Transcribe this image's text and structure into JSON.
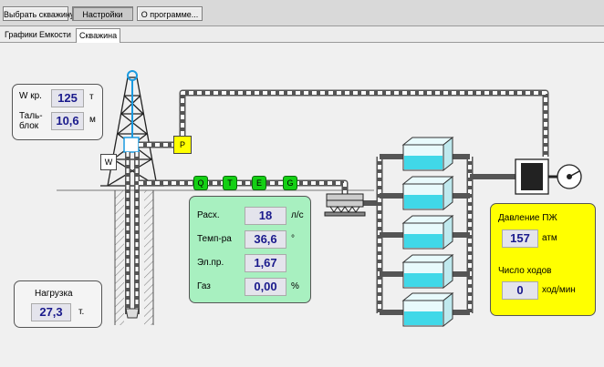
{
  "toolbar": {
    "select_well": "Выбрать скважину",
    "settings": "Настройки",
    "about": "О программе..."
  },
  "tabs": [
    "Графики",
    "Емкости",
    "Скважина"
  ],
  "hook": {
    "w_label": "W кр.",
    "w_value": "125",
    "w_unit": "т",
    "block_label_1": "Таль-",
    "block_label_2": "блок",
    "block_value": "10,6",
    "block_unit": "м"
  },
  "load": {
    "label": "Нагрузка",
    "value": "27,3",
    "unit": "т."
  },
  "sensors": {
    "p": "P",
    "w": "W",
    "q": "Q",
    "t": "T",
    "e": "E",
    "g": "G"
  },
  "fluid": {
    "rows": [
      {
        "label": "Расх.",
        "value": "18",
        "unit": "л/с"
      },
      {
        "label": "Темп-ра",
        "value": "36,6",
        "unit": "°"
      },
      {
        "label": "Эл.пр.",
        "value": "1,67",
        "unit": ""
      },
      {
        "label": "Газ",
        "value": "0,00",
        "unit": "%"
      }
    ]
  },
  "pump": {
    "pressure_label": "Давление ПЖ",
    "pressure_value": "157",
    "pressure_unit": "атм",
    "strokes_label": "Число ходов",
    "strokes_value": "0",
    "strokes_unit": "ход/мин"
  },
  "colors": {
    "fluid_panel": "#a8f0c0",
    "pump_panel": "#ffff00",
    "sensor": "#14d014",
    "tank_liquid": "#40d8e8"
  }
}
